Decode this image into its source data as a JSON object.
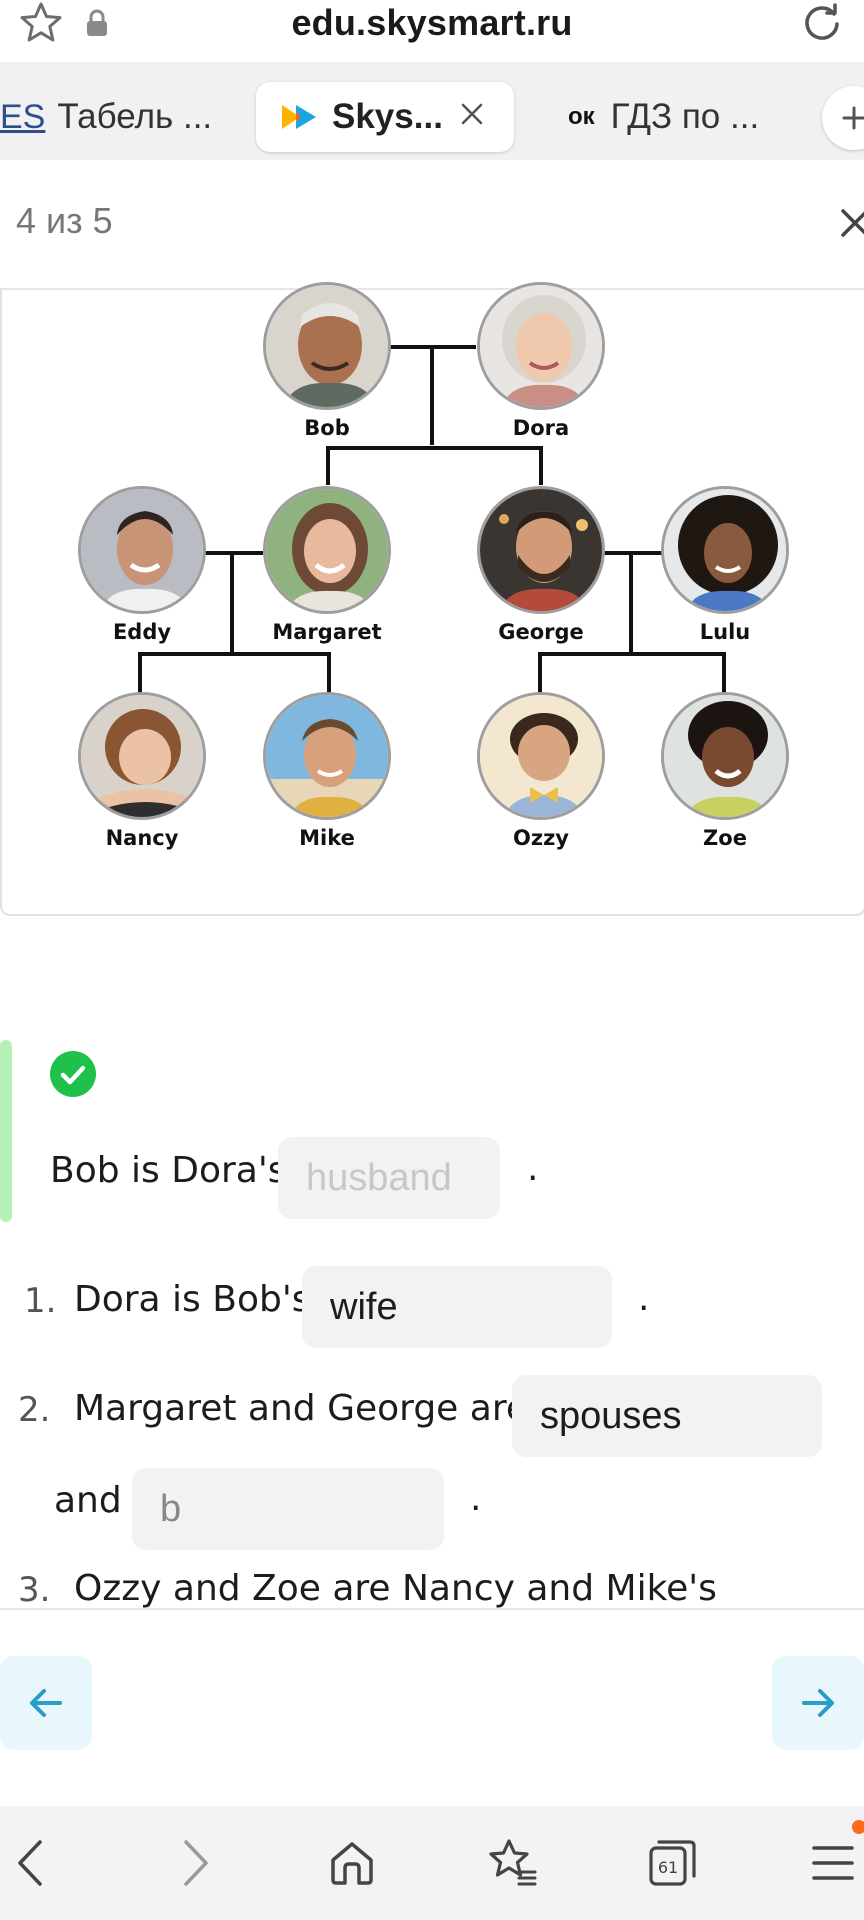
{
  "browser": {
    "url": "edu.skysmart.ru",
    "tabs": [
      {
        "icon": "ES",
        "label": "Табель ..."
      },
      {
        "icon": "skysmart-play-icon",
        "label": "Skys..."
      },
      {
        "icon": "ок",
        "label": "ГДЗ по ..."
      }
    ],
    "tab_count": "61"
  },
  "lesson": {
    "progress": "4 из 5"
  },
  "family_tree": {
    "people": {
      "bob": "Bob",
      "dora": "Dora",
      "eddy": "Eddy",
      "margaret": "Margaret",
      "george": "George",
      "lulu": "Lulu",
      "nancy": "Nancy",
      "mike": "Mike",
      "ozzy": "Ozzy",
      "zoe": "Zoe"
    }
  },
  "exercise": {
    "example": {
      "prefix": "Bob is Dora's",
      "answer": "husband",
      "suffix": "."
    },
    "items": [
      {
        "num": "1.",
        "prefix": "Dora is Bob's",
        "answer": "wife",
        "suffix": "."
      },
      {
        "num": "2.",
        "prefix": "Margaret and George are",
        "answer": "spouses",
        "middle": "and",
        "answer2": "b",
        "suffix": "."
      },
      {
        "num": "3.",
        "prefix": "Ozzy and Zoe are Nancy and Mike's"
      }
    ]
  },
  "colors": {
    "accent": "#2a9dc6",
    "success": "#1fc14a",
    "success_bar": "#b7f0b7",
    "input_bg": "#f1f2f4"
  }
}
